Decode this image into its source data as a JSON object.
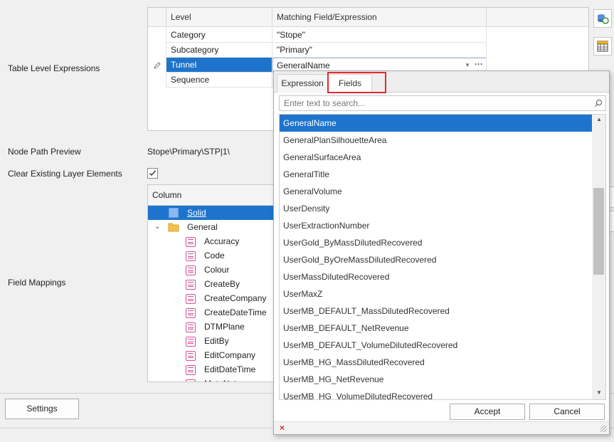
{
  "labels": {
    "table_level_expressions": "Table Level Expressions",
    "node_path_preview": "Node Path Preview",
    "node_path_value": "Stope\\Primary\\STP|1\\",
    "clear_existing": "Clear Existing Layer Elements",
    "field_mappings": "Field Mappings"
  },
  "level_grid": {
    "headers": [
      "Level",
      "Matching Field/Expression"
    ],
    "rows": [
      {
        "level": "Category",
        "expr": "\"Stope\""
      },
      {
        "level": "Subcategory",
        "expr": "\"Primary\""
      },
      {
        "level": "Tunnel",
        "expr": "GeneralName"
      },
      {
        "level": "Sequence",
        "expr": ""
      }
    ],
    "selected_index": 2,
    "ellipsis": "···"
  },
  "clear_existing_checked": true,
  "column_tree": {
    "header": "Column",
    "root": "Solid",
    "group": "General",
    "fields": [
      "Accuracy",
      "Code",
      "Colour",
      "CreateBy",
      "CreateCompany",
      "CreateDateTime",
      "DTMPlane",
      "EditBy",
      "EditCompany",
      "EditDateTime",
      "MetaNotes"
    ]
  },
  "settings_button": "Settings",
  "popup": {
    "tabs": [
      "Expression",
      "Fields"
    ],
    "active_tab": "Fields",
    "search_placeholder": "Enter text to search...",
    "fields": [
      "GeneralName",
      "GeneralPlanSilhouetteArea",
      "GeneralSurfaceArea",
      "GeneralTitle",
      "GeneralVolume",
      "UserDensity",
      "UserExtractionNumber",
      "UserGold_ByMassDilutedRecovered",
      "UserGold_ByOreMassDilutedRecovered",
      "UserMassDilutedRecovered",
      "UserMaxZ",
      "UserMB_DEFAULT_MassDilutedRecovered",
      "UserMB_DEFAULT_NetRevenue",
      "UserMB_DEFAULT_VolumeDilutedRecovered",
      "UserMB_HG_MassDilutedRecovered",
      "UserMB_HG_NetRevenue",
      "UserMB_HG_VolumeDilutedRecovered"
    ],
    "selected_field": "GeneralName",
    "accept": "Accept",
    "cancel": "Cancel",
    "close_glyph": "×"
  },
  "colors": {
    "selection": "#1e74cc",
    "highlight_box": "#e8262b"
  }
}
